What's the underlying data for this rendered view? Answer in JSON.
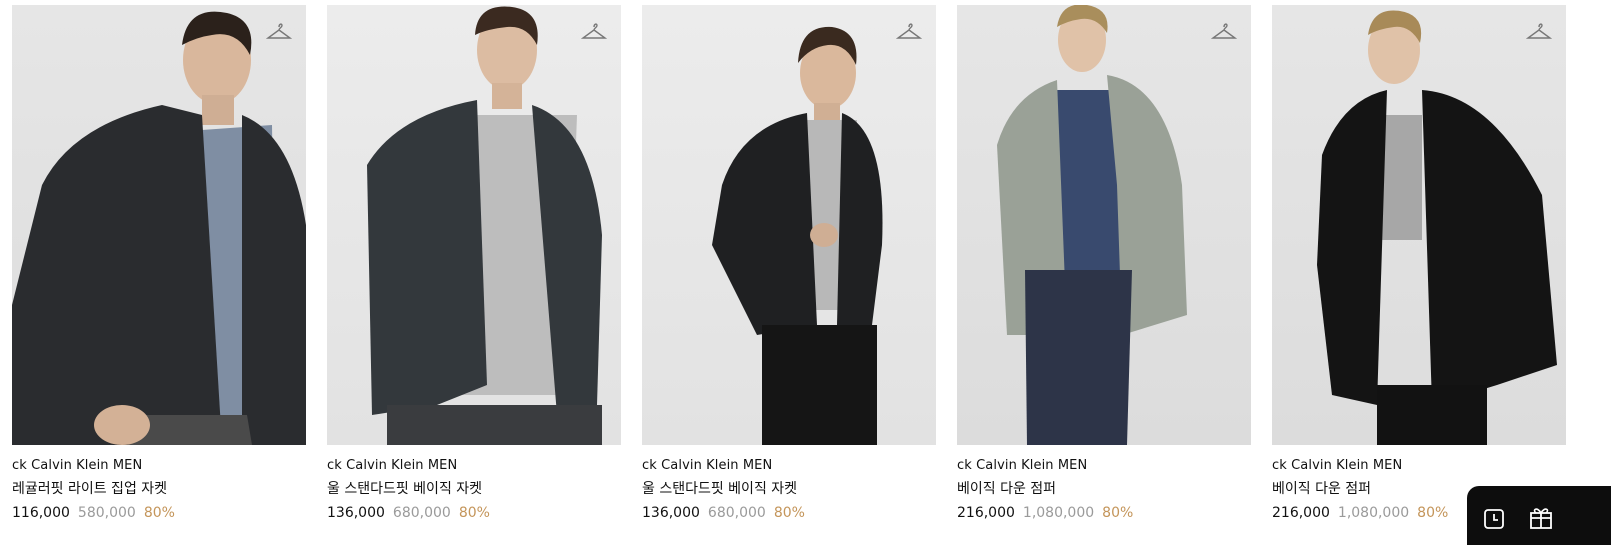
{
  "products": [
    {
      "brand": "ck Calvin Klein MEN",
      "name": "레귤러핏 라이트 집업 자켓",
      "price_sale": "116,000",
      "price_original": "580,000",
      "discount": "80%",
      "jacket_color": "#2a2c2f",
      "inner_color": "#7f8ea3",
      "pants_color": "#4a4a4a"
    },
    {
      "brand": "ck Calvin Klein MEN",
      "name": "울 스탠다드핏 베이직 자켓",
      "price_sale": "136,000",
      "price_original": "680,000",
      "discount": "80%",
      "jacket_color": "#33383c",
      "inner_color": "#bdbdbd",
      "pants_color": "#3a3c3f"
    },
    {
      "brand": "ck Calvin Klein MEN",
      "name": "울 스탠다드핏 베이직 자켓",
      "price_sale": "136,000",
      "price_original": "680,000",
      "discount": "80%",
      "jacket_color": "#1f2022",
      "inner_color": "#b8b8b8",
      "pants_color": "#151515"
    },
    {
      "brand": "ck Calvin Klein MEN",
      "name": "베이직 다운 점퍼",
      "price_sale": "216,000",
      "price_original": "1,080,000",
      "discount": "80%",
      "jacket_color": "#9aa197",
      "inner_color": "#394a6e",
      "pants_color": "#2d3448"
    },
    {
      "brand": "ck Calvin Klein MEN",
      "name": "베이직 다운 점퍼",
      "price_sale": "216,000",
      "price_original": "1,080,000",
      "discount": "80%",
      "jacket_color": "#141414",
      "inner_color": "#a7a7a7",
      "pants_color": "#121212"
    }
  ],
  "icons": {
    "wishlist": "hanger-icon",
    "recent": "clock-icon",
    "gift": "gift-icon"
  },
  "colors": {
    "discount": "#c4955a",
    "original_price": "#9a9a9a",
    "floating_bar": "#0d0d0d"
  }
}
